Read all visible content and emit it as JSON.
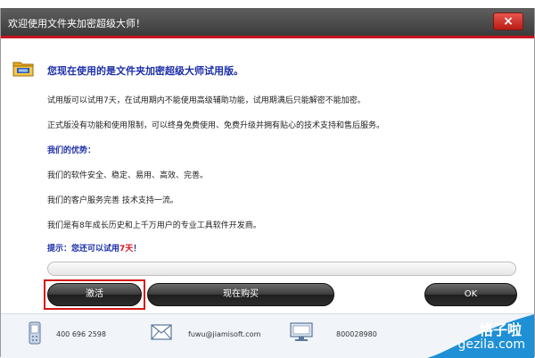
{
  "window": {
    "title": "欢迎使用文件夹加密超级大师！",
    "close_label": "×"
  },
  "content": {
    "headline": "您现在使用的是文件夹加密超级大师试用版。",
    "trial_info": "试用版可以试用7天，在试用期内不能使用高级辅助功能，试用期满后只能解密不能加密。",
    "official_info": "正式版没有功能和使用限制，可以终身免费使用、免费升级并拥有贴心的技术支持和售后服务。",
    "advantages_title": "我们的优势：",
    "advantages": [
      "我们的软件安全、稳定、易用、高效、完善。",
      "我们的客户服务完善 技术支持一流。",
      "我们是有8年成长历史和上千万用户的专业工具软件开发商。"
    ],
    "hint_prefix": "提示：您还可以试用",
    "hint_days": "7天",
    "hint_suffix": "！",
    "progress_fraction": 0.0
  },
  "buttons": {
    "activate": "激活",
    "buy_now": "现在购买",
    "ok": "OK"
  },
  "footer": {
    "phone": "400 696 2598",
    "email": "fuwu@jiamisoft.com",
    "qq": "800028980"
  },
  "watermark": {
    "cn": "格子啦",
    "en": "gezila.com"
  },
  "colors": {
    "title_accent": "#c8141e",
    "text_blue": "#1c2fa8",
    "hint_red": "#d4141e"
  }
}
